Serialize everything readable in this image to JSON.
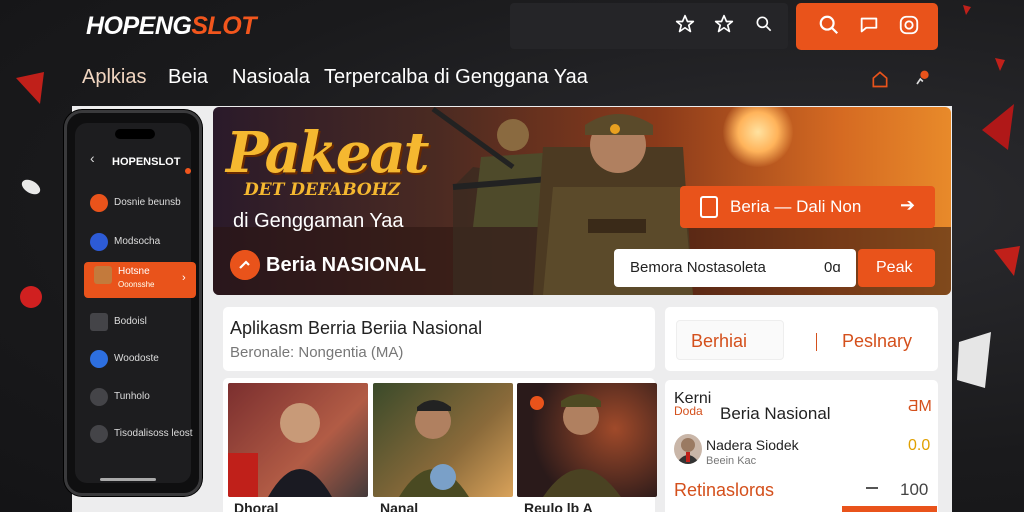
{
  "brand": {
    "logo_main": "HOPENG",
    "logo_accent": "SLOT"
  },
  "nav": {
    "items": [
      "Aplkias",
      "Beia",
      "Nasioala",
      "Terpercalba di Genggana Yaa"
    ]
  },
  "banner": {
    "title": "Pakeat",
    "subtitle": "DET DEFABOHZ",
    "tagline": "di Genggaman Yaa",
    "badge": "Beria NASIONAL",
    "cta": "Beria — Dali Non",
    "search_label": "Bemora Nostasoleta",
    "search_value": "0ɑ",
    "go_label": "Peak"
  },
  "phone": {
    "logo": "HOPENSLOT",
    "items": [
      {
        "label": "Dosnie beunsb",
        "color": "#e9531b"
      },
      {
        "label": "Modsocha",
        "color": "#2d5bd6"
      },
      {
        "label": "Hotsne",
        "sub": "Ooonsshe",
        "color": "#c37a3c"
      },
      {
        "label": "Bodoisl",
        "color": "#444448"
      },
      {
        "label": "Woodoste",
        "color": "#2d6fe0"
      },
      {
        "label": "Tunholo",
        "color": "#444448"
      },
      {
        "label": "Tisodalisoss leost",
        "color": "#444448"
      }
    ]
  },
  "card_main": {
    "title": "Aplikasm Berria Beriia Nasional",
    "subtitle": "Beronale: Nongentia (MA)"
  },
  "tabs": {
    "left": "Berhiai",
    "right": "Peslnary"
  },
  "thumbs": [
    {
      "caption": "Dhoral"
    },
    {
      "caption": "Nanal"
    },
    {
      "caption": "Reulo lb A"
    }
  ],
  "right_list": {
    "head_a": "Kerni",
    "head_b": "Doda",
    "head_title": "Beria Nasional",
    "head_value": "ƋM",
    "person_name": "Nadera Siodek",
    "person_sub": "Beein Kac",
    "person_value": "0.0",
    "row3_label": "Retinaslorɑs",
    "row3_value": "100"
  },
  "colors": {
    "accent": "#e9531b",
    "gold": "#f5b830",
    "panel": "#ededee"
  }
}
